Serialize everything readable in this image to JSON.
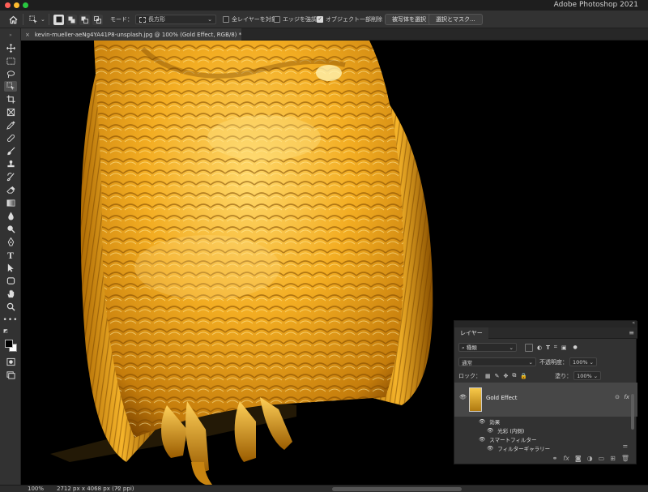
{
  "app": {
    "title": "Adobe Photoshop 2021"
  },
  "options": {
    "mode_label": "モード：",
    "mode_value": "長方形",
    "sample_all_layers": "全レイヤーを対象",
    "enhance_edge": "エッジを強調",
    "object_subtract": "オブジェクト一部削除",
    "select_subject": "被写体を選択",
    "select_and_mask": "選択とマスク..."
  },
  "document": {
    "tab_label": "kevin-mueller-aeNg4YA41P8-unsplash.jpg @ 100% (Gold Effect, RGB/8) *"
  },
  "status": {
    "zoom": "100%",
    "dimensions": "2712 px x 4068 px (72 ppi)",
    "arrow": ">"
  },
  "layers_panel": {
    "tab": "レイヤー",
    "filter_kind": "種類",
    "blend_mode": "通常",
    "opacity_label": "不透明度：",
    "opacity_value": "100%",
    "lock_label": "ロック：",
    "fill_label": "塗り：",
    "fill_value": "100%",
    "layer_name": "Gold Effect",
    "fx_label": "fx",
    "effects_label": "効果",
    "inner_glow": "光彩 (内側)",
    "smart_filters": "スマートフィルター",
    "filter_gallery": "フィルターギャラリー"
  },
  "colors": {
    "gold_light": "#ffd560",
    "gold_mid": "#f0a818",
    "gold_dark": "#8a5200",
    "ui_dark": "#323232"
  }
}
